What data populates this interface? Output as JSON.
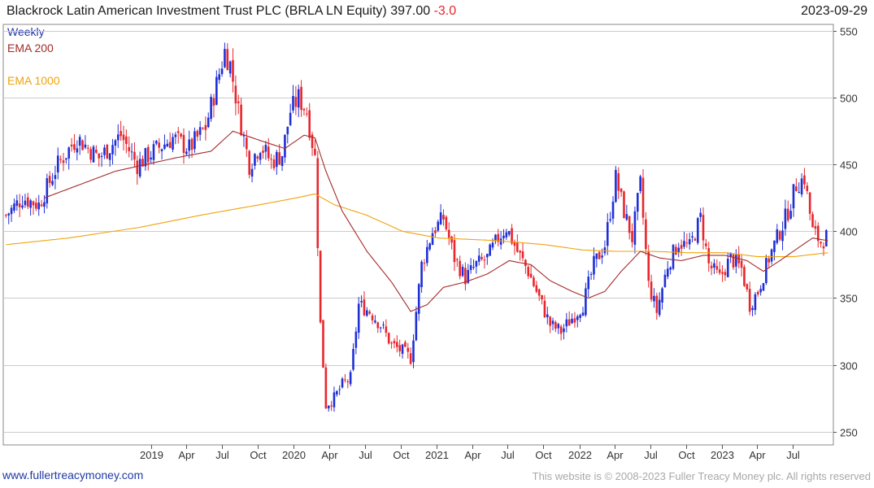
{
  "header": {
    "title": "Blackrock Latin American Investment Trust PLC (BRLA LN Equity) 397.00",
    "change": "-3.0",
    "date": "2023-09-29"
  },
  "legend": {
    "weekly": "Weekly",
    "ema200": "EMA 200",
    "ema1000": "EMA 1000"
  },
  "footer": {
    "url": "www.fullertreacymoney.com",
    "copyright": "This website is © 2008-2023 Fuller Treacy Money plc. All rights reserved"
  },
  "colors": {
    "up": "#1f2fd6",
    "down": "#e8262c",
    "ema200": "#a52a2a",
    "ema1000": "#f0a30a",
    "grid": "#cccccc"
  },
  "chart_data": {
    "type": "candlestick",
    "frequency": "weekly",
    "ylim": [
      240,
      555
    ],
    "y_ticks": [
      250,
      300,
      350,
      400,
      450,
      500,
      550
    ],
    "x_ticks": [
      {
        "date": "2019-01-01",
        "label": "2019"
      },
      {
        "date": "2019-04-01",
        "label": "Apr"
      },
      {
        "date": "2019-07-01",
        "label": "Jul"
      },
      {
        "date": "2019-10-01",
        "label": "Oct"
      },
      {
        "date": "2020-01-01",
        "label": "2020"
      },
      {
        "date": "2020-04-01",
        "label": "Apr"
      },
      {
        "date": "2020-07-01",
        "label": "Jul"
      },
      {
        "date": "2020-10-01",
        "label": "Oct"
      },
      {
        "date": "2021-01-01",
        "label": "2021"
      },
      {
        "date": "2021-04-01",
        "label": "Apr"
      },
      {
        "date": "2021-07-01",
        "label": "Jul"
      },
      {
        "date": "2021-10-01",
        "label": "Oct"
      },
      {
        "date": "2022-01-01",
        "label": "2022"
      },
      {
        "date": "2022-04-01",
        "label": "Apr"
      },
      {
        "date": "2022-07-01",
        "label": "Jul"
      },
      {
        "date": "2022-10-01",
        "label": "Oct"
      },
      {
        "date": "2023-01-01",
        "label": "2023"
      },
      {
        "date": "2023-04-01",
        "label": "Apr"
      },
      {
        "date": "2023-07-01",
        "label": "Jul"
      }
    ],
    "x_range": [
      "2017-12-18",
      "2023-10-13"
    ],
    "close_anchors": [
      [
        "2017-12-25",
        412
      ],
      [
        "2018-02-05",
        425
      ],
      [
        "2018-03-19",
        420
      ],
      [
        "2018-05-07",
        450
      ],
      [
        "2018-06-25",
        470
      ],
      [
        "2018-08-20",
        455
      ],
      [
        "2018-10-15",
        472
      ],
      [
        "2018-11-26",
        450
      ],
      [
        "2019-01-07",
        460
      ],
      [
        "2019-02-25",
        470
      ],
      [
        "2019-04-08",
        462
      ],
      [
        "2019-05-20",
        478
      ],
      [
        "2019-06-17",
        510
      ],
      [
        "2019-07-08",
        535
      ],
      [
        "2019-07-22",
        525
      ],
      [
        "2019-08-12",
        490
      ],
      [
        "2019-09-09",
        450
      ],
      [
        "2019-10-07",
        465
      ],
      [
        "2019-11-04",
        452
      ],
      [
        "2019-12-02",
        458
      ],
      [
        "2019-12-23",
        490
      ],
      [
        "2020-01-13",
        500
      ],
      [
        "2020-02-03",
        490
      ],
      [
        "2020-02-24",
        455
      ],
      [
        "2020-03-09",
        330
      ],
      [
        "2020-03-23",
        270
      ],
      [
        "2020-04-13",
        275
      ],
      [
        "2020-05-04",
        285
      ],
      [
        "2020-05-25",
        290
      ],
      [
        "2020-06-15",
        345
      ],
      [
        "2020-07-13",
        340
      ],
      [
        "2020-08-10",
        330
      ],
      [
        "2020-09-07",
        315
      ],
      [
        "2020-10-05",
        310
      ],
      [
        "2020-10-26",
        305
      ],
      [
        "2020-11-23",
        375
      ],
      [
        "2020-12-21",
        400
      ],
      [
        "2021-01-18",
        410
      ],
      [
        "2021-02-15",
        380
      ],
      [
        "2021-03-15",
        365
      ],
      [
        "2021-04-12",
        375
      ],
      [
        "2021-05-10",
        380
      ],
      [
        "2021-06-07",
        395
      ],
      [
        "2021-06-28",
        403
      ],
      [
        "2021-07-26",
        385
      ],
      [
        "2021-08-23",
        370
      ],
      [
        "2021-09-20",
        350
      ],
      [
        "2021-10-18",
        330
      ],
      [
        "2021-11-15",
        325
      ],
      [
        "2021-12-13",
        335
      ],
      [
        "2022-01-10",
        345
      ],
      [
        "2022-02-07",
        375
      ],
      [
        "2022-03-07",
        390
      ],
      [
        "2022-04-04",
        440
      ],
      [
        "2022-04-25",
        415
      ],
      [
        "2022-05-16",
        395
      ],
      [
        "2022-06-06",
        435
      ],
      [
        "2022-06-27",
        360
      ],
      [
        "2022-07-18",
        340
      ],
      [
        "2022-08-15",
        375
      ],
      [
        "2022-09-12",
        392
      ],
      [
        "2022-10-10",
        388
      ],
      [
        "2022-11-07",
        410
      ],
      [
        "2022-11-28",
        375
      ],
      [
        "2022-12-26",
        365
      ],
      [
        "2023-01-23",
        380
      ],
      [
        "2023-02-20",
        372
      ],
      [
        "2023-03-13",
        345
      ],
      [
        "2023-04-03",
        355
      ],
      [
        "2023-05-01",
        380
      ],
      [
        "2023-05-29",
        400
      ],
      [
        "2023-06-19",
        415
      ],
      [
        "2023-07-10",
        435
      ],
      [
        "2023-07-31",
        440
      ],
      [
        "2023-08-21",
        400
      ],
      [
        "2023-09-11",
        392
      ],
      [
        "2023-09-29",
        397
      ]
    ],
    "ema200_anchors": [
      [
        "2018-04-02",
        425
      ],
      [
        "2018-10-01",
        445
      ],
      [
        "2019-03-04",
        455
      ],
      [
        "2019-06-03",
        460
      ],
      [
        "2019-07-29",
        475
      ],
      [
        "2019-10-07",
        468
      ],
      [
        "2019-12-09",
        462
      ],
      [
        "2020-01-27",
        472
      ],
      [
        "2020-02-24",
        470
      ],
      [
        "2020-03-23",
        445
      ],
      [
        "2020-05-04",
        415
      ],
      [
        "2020-07-06",
        385
      ],
      [
        "2020-09-07",
        362
      ],
      [
        "2020-10-26",
        340
      ],
      [
        "2020-12-07",
        345
      ],
      [
        "2021-01-18",
        358
      ],
      [
        "2021-03-15",
        362
      ],
      [
        "2021-05-10",
        368
      ],
      [
        "2021-07-05",
        378
      ],
      [
        "2021-08-30",
        375
      ],
      [
        "2021-10-18",
        363
      ],
      [
        "2021-12-13",
        355
      ],
      [
        "2022-01-24",
        350
      ],
      [
        "2022-03-07",
        355
      ],
      [
        "2022-04-18",
        370
      ],
      [
        "2022-06-06",
        385
      ],
      [
        "2022-07-25",
        380
      ],
      [
        "2022-09-19",
        378
      ],
      [
        "2022-11-14",
        382
      ],
      [
        "2023-01-09",
        382
      ],
      [
        "2023-03-06",
        378
      ],
      [
        "2023-04-17",
        370
      ],
      [
        "2023-05-29",
        378
      ],
      [
        "2023-07-17",
        388
      ],
      [
        "2023-08-21",
        395
      ],
      [
        "2023-09-29",
        393
      ]
    ],
    "ema1000_anchors": [
      [
        "2017-12-25",
        390
      ],
      [
        "2018-06-04",
        395
      ],
      [
        "2018-12-03",
        403
      ],
      [
        "2019-05-06",
        412
      ],
      [
        "2019-10-07",
        420
      ],
      [
        "2020-01-06",
        425
      ],
      [
        "2020-02-24",
        428
      ],
      [
        "2020-04-13",
        420
      ],
      [
        "2020-07-06",
        412
      ],
      [
        "2020-10-05",
        400
      ],
      [
        "2021-01-04",
        395
      ],
      [
        "2021-06-07",
        393
      ],
      [
        "2021-10-04",
        390
      ],
      [
        "2022-01-10",
        386
      ],
      [
        "2022-04-04",
        385
      ],
      [
        "2022-07-04",
        385
      ],
      [
        "2022-10-03",
        384
      ],
      [
        "2023-01-09",
        384
      ],
      [
        "2023-04-03",
        381
      ],
      [
        "2023-07-03",
        381
      ],
      [
        "2023-09-29",
        384
      ]
    ]
  }
}
